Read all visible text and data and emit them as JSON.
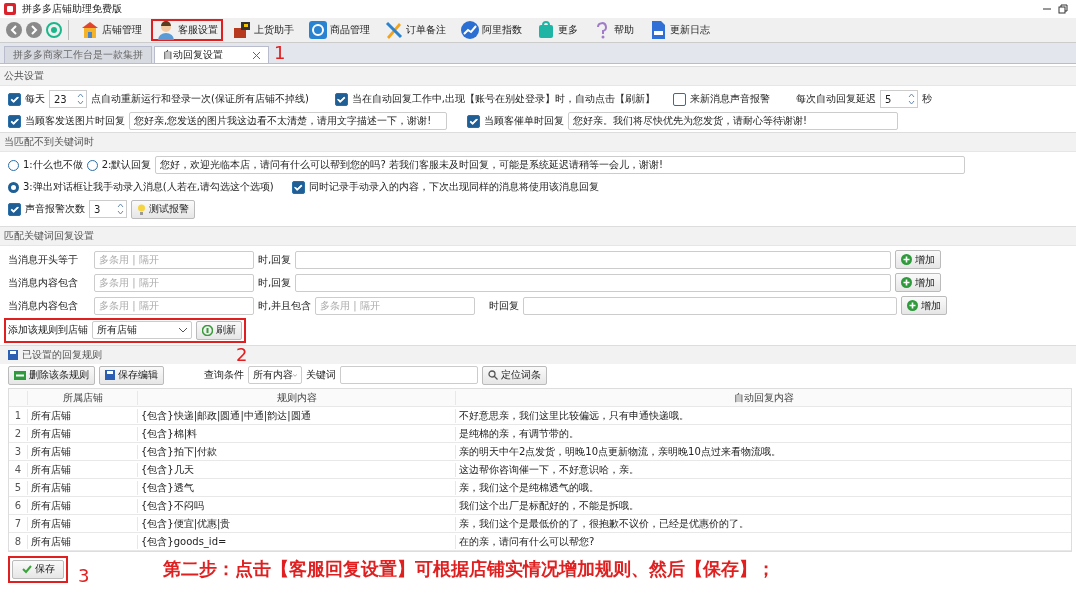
{
  "window": {
    "title": "拼多多店铺助理免费版"
  },
  "toolbar": [
    {
      "label": "店铺管理",
      "highlighted": false
    },
    {
      "label": "客服设置",
      "highlighted": true
    },
    {
      "label": "上货助手",
      "highlighted": false
    },
    {
      "label": "商品管理",
      "highlighted": false
    },
    {
      "label": "订单备注",
      "highlighted": false
    },
    {
      "label": "阿里指数",
      "highlighted": false
    },
    {
      "label": "更多",
      "highlighted": false
    },
    {
      "label": "帮助",
      "highlighted": false
    },
    {
      "label": "更新日志",
      "highlighted": false
    }
  ],
  "tabs": [
    {
      "label": "拼多多商家工作台是一款集拼",
      "selected": false,
      "closable": false
    },
    {
      "label": "自动回复设置",
      "selected": true,
      "closable": true
    }
  ],
  "public_settings": {
    "title": "公共设置",
    "daily_restart": {
      "checked": true,
      "label": "每天",
      "value": "23",
      "suffix": "点自动重新运行和登录一次(保证所有店铺不掉线)"
    },
    "auto_refresh": {
      "checked": true,
      "label": "当在自动回复工作中,出现【账号在别处登录】时，自动点击【刷新】"
    },
    "sound_alert": {
      "checked": false,
      "label": "来新消息声音报警"
    },
    "delay": {
      "label": "每次自动回复延迟",
      "value": "5",
      "unit": "秒"
    },
    "image_reply": {
      "checked": true,
      "label": "当顾客发送图片时回复",
      "value": "您好亲,您发送的图片我这边看不太清楚，请用文字描述一下，谢谢!"
    },
    "urge_reply": {
      "checked": true,
      "label": "当顾客催单时回复",
      "value": "您好亲。我们将尽快优先为您发货，请耐心等待谢谢!"
    }
  },
  "no_match": {
    "title": "当匹配不到关键词时",
    "options": [
      {
        "label": "1:什么也不做",
        "selected": false
      },
      {
        "label": "2:默认回复",
        "selected": false
      },
      {
        "label": "3:弹出对话框让我手动录入消息(人若在,请勾选这个选项)",
        "selected": true
      }
    ],
    "default_reply": "您好，欢迎光临本店，请问有什么可以帮到您的吗? 若我们客服未及时回复，可能是系统延迟请稍等一会儿，谢谢!",
    "record": {
      "checked": true,
      "label": "同时记录手动录入的内容，下次出现同样的消息将使用该消息回复"
    },
    "sound_count": {
      "checked": true,
      "label": "声音报警次数",
      "value": "3"
    },
    "test_button": "测试报警"
  },
  "keyword": {
    "title": "匹配关键词回复设置",
    "rules": [
      {
        "kind": "simple",
        "label": "当消息开头等于",
        "placeholder": "多条用 | 隔开",
        "reply_label": "时,回复",
        "button": "增加"
      },
      {
        "kind": "simple",
        "label": "当消息内容包含",
        "placeholder": "多条用 | 隔开",
        "reply_label": "时,回复",
        "button": "增加"
      },
      {
        "kind": "double",
        "label": "当消息内容包含",
        "placeholder": "多条用 | 隔开",
        "and_label": "时,并且包含",
        "and_placeholder": "多条用 | 隔开",
        "reply_label": "时回复",
        "button": "增加"
      }
    ],
    "shop": {
      "label": "添加该规则到店铺",
      "value": "所有店铺",
      "button": "刷新",
      "highlighted": true
    }
  },
  "saved_rules": {
    "title": "已设置的回复规则",
    "delete_button": "删除该条规则",
    "save_button": "保存编辑",
    "filter_label": "查询条件",
    "filter_value": "所有内容",
    "keyword_label": "关键词",
    "locate_button": "定位词条",
    "columns": [
      "所属店铺",
      "规则内容",
      "自动回复内容"
    ],
    "rows": [
      {
        "num": "1",
        "shop": "所有店铺",
        "rule": "{包含}快递|邮政|圆通|中通|韵达|圆通",
        "reply": "不好意思亲，我们这里比较偏远，只有申通快递哦。"
      },
      {
        "num": "2",
        "shop": "所有店铺",
        "rule": "{包含}棉|料",
        "reply": "是纯棉的亲，有调节带的。"
      },
      {
        "num": "3",
        "shop": "所有店铺",
        "rule": "{包含}拍下|付款",
        "reply": "亲的明天中午2点发货，明晚10点更新物流，亲明晚10点过来看物流哦。"
      },
      {
        "num": "4",
        "shop": "所有店铺",
        "rule": "{包含}几天",
        "reply": "这边帮你咨询催一下，不好意识哈，亲。"
      },
      {
        "num": "5",
        "shop": "所有店铺",
        "rule": "{包含}透气",
        "reply": "亲，我们这个是纯棉透气的哦。"
      },
      {
        "num": "6",
        "shop": "所有店铺",
        "rule": "{包含}不闷吗",
        "reply": "我们这个出厂是标配好的，不能是拆哦。"
      },
      {
        "num": "7",
        "shop": "所有店铺",
        "rule": "{包含}便宜|优惠|贵",
        "reply": "亲，我们这个是最低价的了，很抱歉不议价，已经是优惠价的了。"
      },
      {
        "num": "8",
        "shop": "所有店铺",
        "rule": "{包含}goods_id=",
        "reply": "在的亲，请问有什么可以帮您?"
      }
    ]
  },
  "footer": {
    "save_button": "保存",
    "highlighted": true
  },
  "annotations": {
    "markers": [
      "1",
      "2",
      "3"
    ],
    "instruction": "第二步：点击【客服回复设置】可根据店铺实情况增加规则、然后【保存】；"
  }
}
